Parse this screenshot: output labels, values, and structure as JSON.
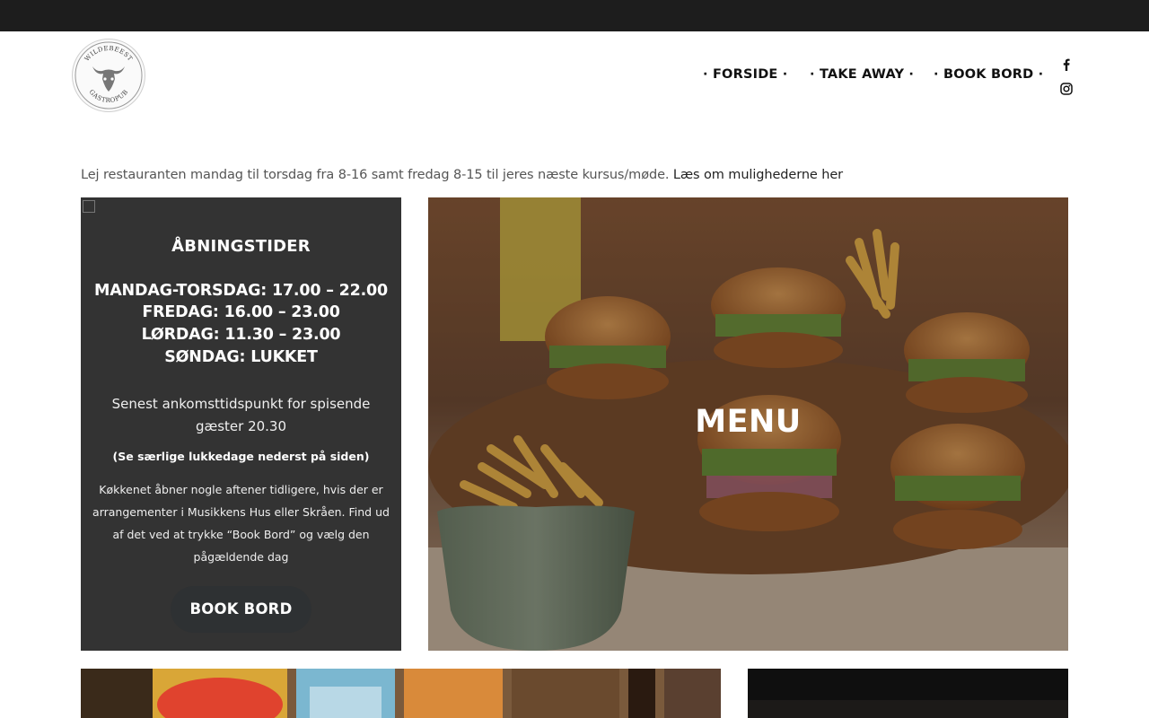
{
  "header": {
    "logo_text_top": "WILDEBEEST",
    "logo_text_bottom": "GASTROPUB",
    "nav": [
      {
        "label": "· FORSIDE ·"
      },
      {
        "label": "· TAKE AWAY ·"
      },
      {
        "label": "· BOOK BORD ·"
      }
    ],
    "social": [
      "facebook-icon",
      "instagram-icon"
    ]
  },
  "notice": {
    "text": "Lej restauranten mandag til torsdag fra 8-16 samt fredag 8-15 til jeres næste kursus/møde. ",
    "link": "Læs om mulighederne her"
  },
  "hours": {
    "title": "ÅBNINGSTIDER",
    "lines": [
      "MANDAG-TORSDAG: 17.00 – 22.00",
      "FREDAG: 16.00 – 23.00",
      "LØRDAG: 11.30 – 23.00",
      "SØNDAG: LUKKET"
    ],
    "latest_arrival": "Senest ankomsttidspunkt for spisende gæster 20.30",
    "special_days": "(Se særlige lukkedage nederst på siden)",
    "kitchen_note": "Køkkenet åbner nogle aftener tidligere, hvis der er arrangementer i Musikkens Hus eller Skråen. Find ud af det ved at trykke “Book Bord” og vælg den pågældende dag",
    "book_button": "BOOK BORD"
  },
  "menu_tile": {
    "label": "MENU"
  },
  "colors": {
    "topbar": "#1d1d1d",
    "hours_bg": "#333333",
    "button_bg": "#2e3133"
  }
}
